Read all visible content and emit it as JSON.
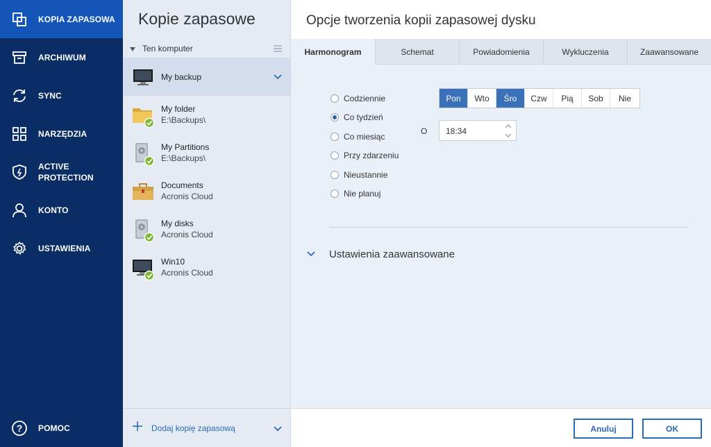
{
  "nav": {
    "items": [
      {
        "label": "KOPIA ZAPASOWA",
        "icon": "copy-icon"
      },
      {
        "label": "ARCHIWUM",
        "icon": "archive-icon"
      },
      {
        "label": "SYNC",
        "icon": "sync-icon"
      },
      {
        "label": "NARZĘDZIA",
        "icon": "tools-grid-icon"
      },
      {
        "label": "ACTIVE PROTECTION",
        "icon": "shield-icon"
      },
      {
        "label": "KONTO",
        "icon": "user-icon"
      },
      {
        "label": "USTAWIENIA",
        "icon": "gear-icon"
      }
    ],
    "help_label": "POMOC"
  },
  "list": {
    "title": "Kopie zapasowe",
    "group_label": "Ten komputer",
    "items": [
      {
        "name": "My backup",
        "location": ""
      },
      {
        "name": "My folder",
        "location": "E:\\Backups\\"
      },
      {
        "name": "My Partitions",
        "location": "E:\\Backups\\"
      },
      {
        "name": "Documents",
        "location": "Acronis Cloud"
      },
      {
        "name": "My disks",
        "location": "Acronis Cloud"
      },
      {
        "name": "Win10",
        "location": "Acronis Cloud"
      }
    ],
    "add_label": "Dodaj kopię zapasową"
  },
  "main": {
    "title": "Opcje tworzenia kopii zapasowej dysku",
    "tabs": [
      "Harmonogram",
      "Schemat",
      "Powiadomienia",
      "Wykluczenia",
      "Zaawansowane"
    ],
    "schedule_options": [
      "Codziennie",
      "Co tydzień",
      "Co miesiąc",
      "Przy zdarzeniu",
      "Nieustannie",
      "Nie planuj"
    ],
    "selected_option": "Co tydzień",
    "days": [
      "Pon",
      "Wto",
      "Śro",
      "Czw",
      "Pią",
      "Sob",
      "Nie"
    ],
    "selected_days": [
      "Pon",
      "Śro"
    ],
    "at_label": "O",
    "time": "18:34",
    "advanced_label": "Ustawienia zaawansowane"
  },
  "footer": {
    "cancel_label": "Anuluj",
    "ok_label": "OK"
  },
  "colors": {
    "nav_bg": "#092d64",
    "nav_active": "#1356b8",
    "accent": "#2a6ab8",
    "check_green": "#7cb82f"
  }
}
